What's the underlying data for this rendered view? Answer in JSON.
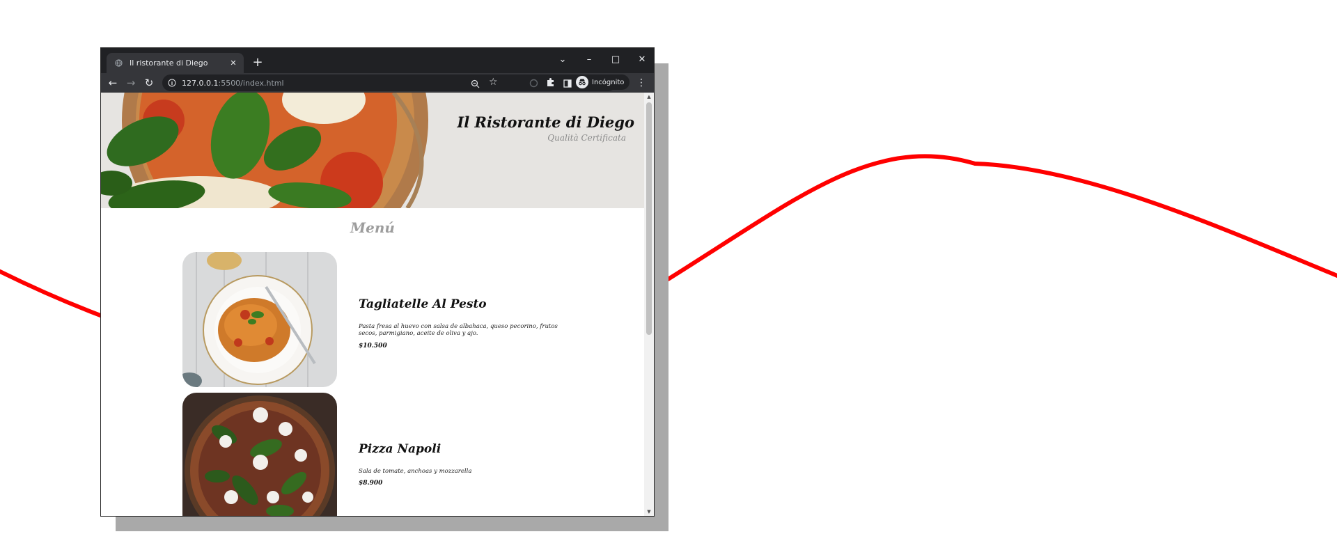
{
  "colors": {
    "wave": "#ff0000",
    "chrome_dark": "#202124",
    "chrome_tab": "#35363a",
    "menu_heading": "#9d9d9d"
  },
  "browser": {
    "tab_title": "Il ristorante di Diego",
    "tab_favicon": "globe-icon",
    "url_host": "127.0.0.1",
    "url_path": ":5500/index.html",
    "profile_label": "Incógnito",
    "icons": [
      "back-arrow-icon",
      "forward-arrow-icon",
      "reload-icon",
      "info-icon",
      "zoom-out-icon",
      "star-icon",
      "extension-icon",
      "side-panel-icon",
      "incognito-icon",
      "kebab-menu-icon"
    ]
  },
  "site": {
    "title": "Il Ristorante di Diego",
    "subtitle": "Qualità Certificata",
    "menu_heading": "Menú"
  },
  "dishes": [
    {
      "name": "Tagliatelle Al Pesto",
      "description": "Pasta fresa al huevo con salsa de albahaca, queso pecorino, frutos secos, parmigiano, aceite de oliva y ajo.",
      "price": "$10.500"
    },
    {
      "name": "Pizza Napoli",
      "description": "Sala de tomate, anchoas y mozzarella",
      "price": "$8.900"
    }
  ]
}
